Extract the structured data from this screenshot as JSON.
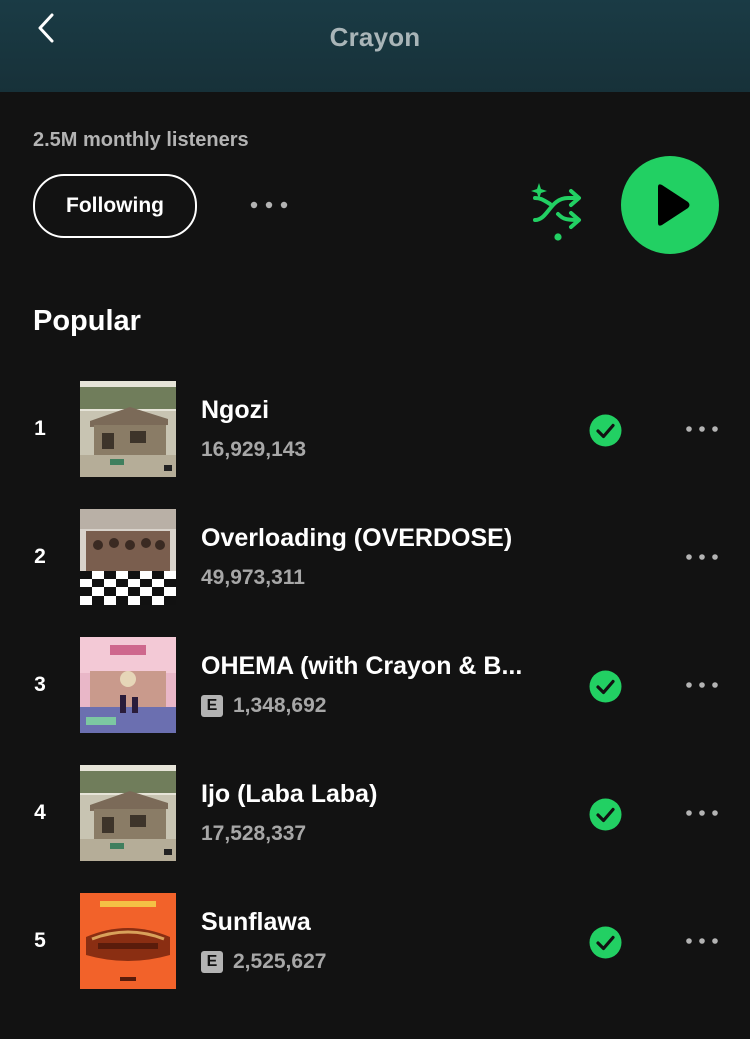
{
  "header": {
    "title": "Crayon",
    "back_icon": "chevron-left-icon"
  },
  "artist": {
    "monthly_listeners": "2.5M monthly listeners",
    "follow_label": "Following",
    "more_icon": "more-horizontal-icon",
    "shuffle_icon": "shuffle-icon",
    "play_icon": "play-icon"
  },
  "colors": {
    "accent": "#22d063",
    "header_bg": "#1a3b45",
    "background": "#121212",
    "secondary_text": "#b3b3b3"
  },
  "popular": {
    "title": "Popular",
    "tracks": [
      {
        "number": "1",
        "title": "Ngozi",
        "plays": "16,929,143",
        "explicit": false,
        "saved": true
      },
      {
        "number": "2",
        "title": "Overloading (OVERDOSE)",
        "plays": "49,973,311",
        "explicit": false,
        "saved": false
      },
      {
        "number": "3",
        "title": "OHEMA (with Crayon & B...",
        "plays": "1,348,692",
        "explicit": true,
        "explicit_label": "E",
        "saved": true
      },
      {
        "number": "4",
        "title": "Ijo (Laba Laba)",
        "plays": "17,528,337",
        "explicit": false,
        "saved": true
      },
      {
        "number": "5",
        "title": "Sunflawa",
        "plays": "2,525,627",
        "explicit": true,
        "explicit_label": "E",
        "saved": true
      }
    ]
  }
}
